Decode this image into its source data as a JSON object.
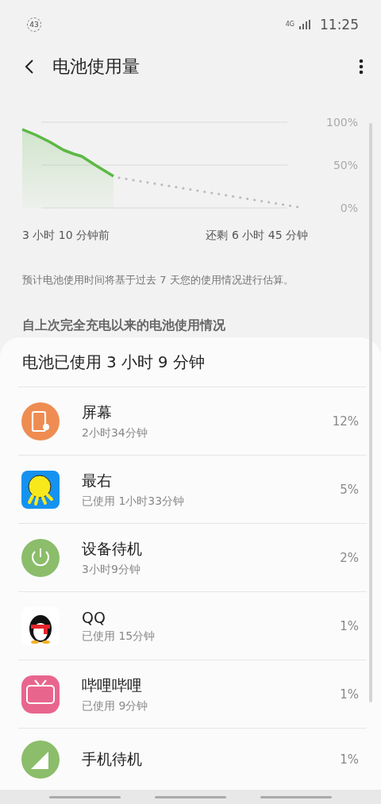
{
  "status_bar": {
    "notification_count": "43",
    "network": "4G",
    "time": "11:25"
  },
  "header": {
    "title": "电池使用量"
  },
  "chart": {
    "axis_labels": [
      "100%",
      "50%",
      "0%"
    ]
  },
  "chart_labels": {
    "start": "3 小时 10 分钟前",
    "end": "还剩 6 小时 45 分钟"
  },
  "note": "预计电池使用时间将基于过去 7 天您的使用情况进行估算。",
  "section_title": "自上次完全充电以来的电池使用情况",
  "card": {
    "title": "电池已使用 3 小时 9 分钟",
    "items": [
      {
        "kind": "screen",
        "name": "屏幕",
        "detail": "2小时34分钟",
        "percent": "12%"
      },
      {
        "kind": "face",
        "name": "最右",
        "detail": "已使用 1小时33分钟",
        "percent": "5%"
      },
      {
        "kind": "power",
        "name": "设备待机",
        "detail": "3小时9分钟",
        "percent": "2%"
      },
      {
        "kind": "penguin",
        "name": "QQ",
        "detail": "已使用 15分钟",
        "percent": "1%"
      },
      {
        "kind": "tv",
        "name": "哔哩哔哩",
        "detail": "已使用 9分钟",
        "percent": "1%"
      },
      {
        "kind": "signal",
        "name": "手机待机",
        "percent": "1%"
      }
    ]
  }
}
